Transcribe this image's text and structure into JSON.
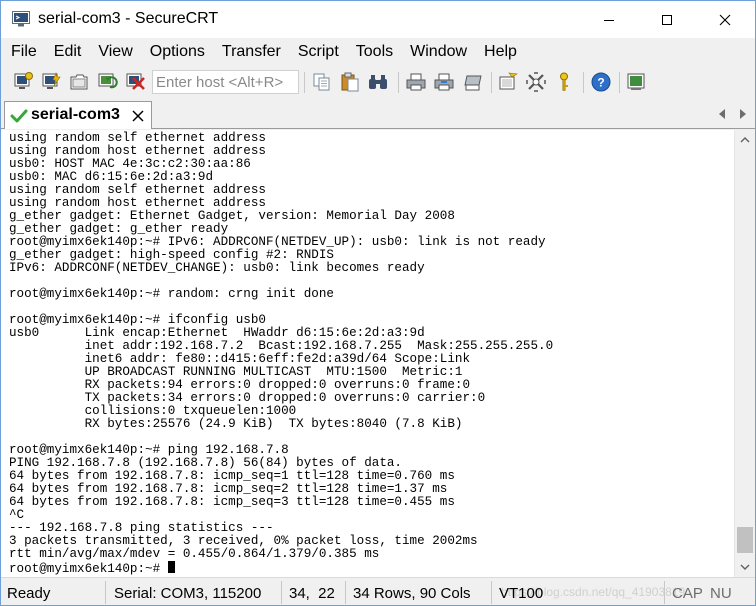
{
  "window": {
    "title": "serial-com3 - SecureCRT"
  },
  "menu": [
    "File",
    "Edit",
    "View",
    "Options",
    "Transfer",
    "Script",
    "Tools",
    "Window",
    "Help"
  ],
  "toolbar": {
    "host_placeholder": "Enter host <Alt+R>",
    "icons": [
      "connect-icon",
      "quick-connect-icon",
      "connect-in-tab-icon",
      "reconnect-icon",
      "disconnect-icon",
      "copy-icon",
      "paste-icon",
      "find-icon",
      "print-icon",
      "print-selection-icon",
      "print-screen-icon",
      "session-options-icon",
      "keymap-icon",
      "sftp-key-icon",
      "help-icon",
      "script-icon"
    ]
  },
  "tabs": [
    {
      "label": "serial-com3",
      "active": true,
      "status": "connected"
    }
  ],
  "terminal": {
    "lines": [
      "using random self ethernet address",
      "using random host ethernet address",
      "usb0: HOST MAC 4e:3c:c2:30:aa:86",
      "usb0: MAC d6:15:6e:2d:a3:9d",
      "using random self ethernet address",
      "using random host ethernet address",
      "g_ether gadget: Ethernet Gadget, version: Memorial Day 2008",
      "g_ether gadget: g_ether ready",
      "root@myimx6ek140p:~# IPv6: ADDRCONF(NETDEV_UP): usb0: link is not ready",
      "g_ether gadget: high-speed config #2: RNDIS",
      "IPv6: ADDRCONF(NETDEV_CHANGE): usb0: link becomes ready",
      "",
      "root@myimx6ek140p:~# random: crng init done",
      "",
      "root@myimx6ek140p:~# ifconfig usb0",
      "usb0      Link encap:Ethernet  HWaddr d6:15:6e:2d:a3:9d  ",
      "          inet addr:192.168.7.2  Bcast:192.168.7.255  Mask:255.255.255.0",
      "          inet6 addr: fe80::d415:6eff:fe2d:a39d/64 Scope:Link",
      "          UP BROADCAST RUNNING MULTICAST  MTU:1500  Metric:1",
      "          RX packets:94 errors:0 dropped:0 overruns:0 frame:0",
      "          TX packets:34 errors:0 dropped:0 overruns:0 carrier:0",
      "          collisions:0 txqueuelen:1000 ",
      "          RX bytes:25576 (24.9 KiB)  TX bytes:8040 (7.8 KiB)",
      "",
      "root@myimx6ek140p:~# ping 192.168.7.8",
      "PING 192.168.7.8 (192.168.7.8) 56(84) bytes of data.",
      "64 bytes from 192.168.7.8: icmp_seq=1 ttl=128 time=0.760 ms",
      "64 bytes from 192.168.7.8: icmp_seq=2 ttl=128 time=1.37 ms",
      "64 bytes from 192.168.7.8: icmp_seq=3 ttl=128 time=0.455 ms",
      "^C",
      "--- 192.168.7.8 ping statistics ---",
      "3 packets transmitted, 3 received, 0% packet loss, time 2002ms",
      "rtt min/avg/max/mdev = 0.455/0.864/1.379/0.385 ms",
      "root@myimx6ek140p:~# "
    ],
    "colors": {
      "background": "#ffffff",
      "foreground": "#000000"
    }
  },
  "status": {
    "state": "Ready",
    "connection": "Serial: COM3, 115200",
    "cursor": "34,  22",
    "size": "34 Rows, 90 Cols",
    "emulation": "VT100",
    "caps": "CAP",
    "num": "NU"
  },
  "watermark": "https://blog.csdn.net/qq_41903819",
  "colors": {
    "accent": "#2d7fd6",
    "connected": "#35a73b",
    "chrome": "#f0f0f0"
  }
}
